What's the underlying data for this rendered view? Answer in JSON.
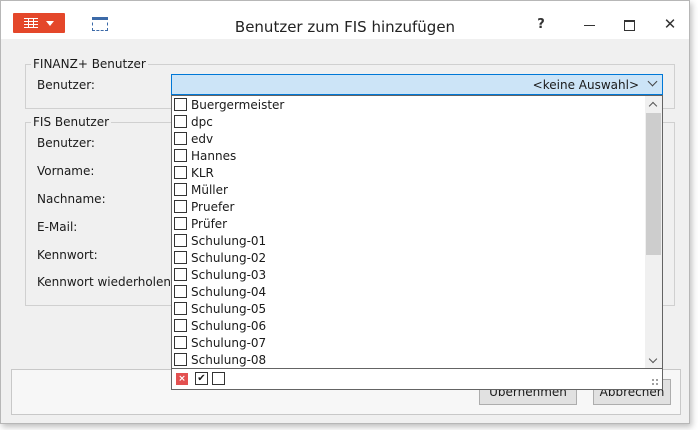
{
  "window": {
    "title": "Benutzer zum FIS hinzufügen",
    "help": "?",
    "close": "✕"
  },
  "finanz_group": {
    "title": "FINANZ+ Benutzer",
    "user_label": "Benutzer:",
    "combo_value": "<keine Auswahl>"
  },
  "fis_group": {
    "title": "FIS Benutzer",
    "fields": [
      {
        "label": "Benutzer:"
      },
      {
        "label": "Vorname:"
      },
      {
        "label": "Nachname:"
      },
      {
        "label": "E-Mail:"
      },
      {
        "label": "Kennwort:"
      },
      {
        "label": "Kennwort wiederholen:"
      }
    ]
  },
  "dropdown": {
    "items": [
      {
        "label": "Buergermeister"
      },
      {
        "label": "dpc"
      },
      {
        "label": "edv"
      },
      {
        "label": "Hannes"
      },
      {
        "label": "KLR"
      },
      {
        "label": "Müller"
      },
      {
        "label": "Pruefer"
      },
      {
        "label": "Prüfer"
      },
      {
        "label": "Schulung-01"
      },
      {
        "label": "Schulung-02"
      },
      {
        "label": "Schulung-03"
      },
      {
        "label": "Schulung-04"
      },
      {
        "label": "Schulung-05"
      },
      {
        "label": "Schulung-06"
      },
      {
        "label": "Schulung-07"
      },
      {
        "label": "Schulung-08"
      }
    ]
  },
  "buttons": {
    "ok": "Übernehmen",
    "cancel": "Abbrechen"
  },
  "colors": {
    "app_menu": "#e4472a",
    "combo_bg": "#cce4f7",
    "combo_border": "#0078d7"
  }
}
